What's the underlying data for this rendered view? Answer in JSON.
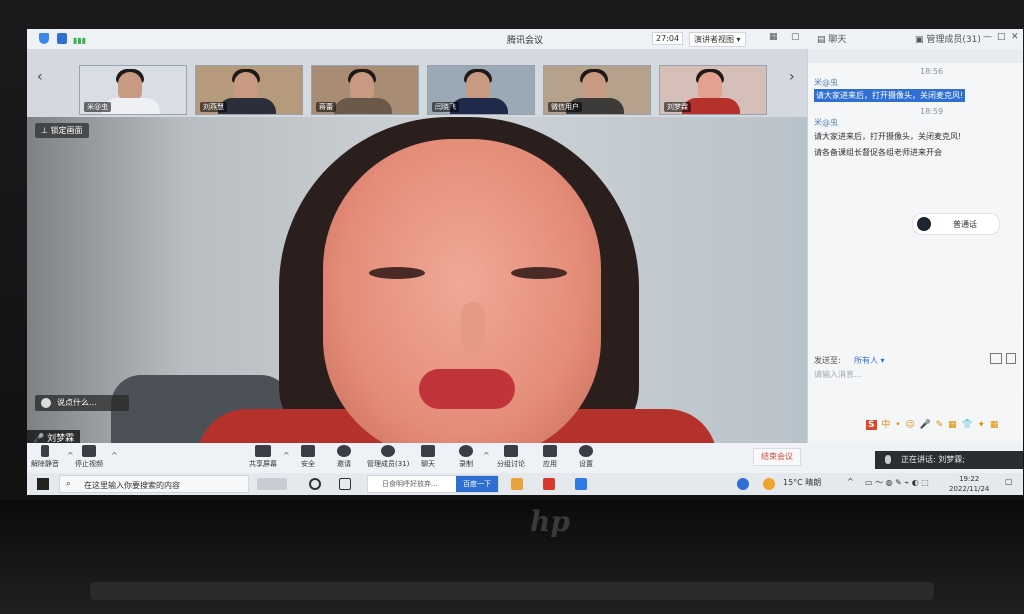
{
  "window": {
    "title": "腾讯会议",
    "timer": "27:04",
    "view_mode": "演讲者视图",
    "chat_tab": "聊天",
    "members_tab": "管理成员(31)"
  },
  "participants": [
    {
      "name": "米@虫"
    },
    {
      "name": "刘燕慧"
    },
    {
      "name": "蒋蕾"
    },
    {
      "name": "闫晓飞"
    },
    {
      "name": "微信用户"
    },
    {
      "name": "刘梦霖"
    }
  ],
  "main_video": {
    "lock_label": "锁定画面",
    "say_placeholder": "说点什么...",
    "speaker_name": "刘梦霖"
  },
  "chat": {
    "messages": [
      {
        "time": "18:56",
        "sender": "米@虫",
        "text": "请大家进来后，打开摄像头，关闭麦克风!"
      },
      {
        "time": "18:59",
        "sender": "米@虫",
        "text": "请大家进来后，打开摄像头，关闭麦克风!"
      },
      {
        "time": "",
        "sender": "",
        "text": "请各备课组长督促各组老师进来开会"
      }
    ],
    "call_label": "普通话",
    "send_to_label": "发送至:",
    "send_to_value": "所有人",
    "input_placeholder": "请输入消息..."
  },
  "toolbar": {
    "unmute": "解除静音",
    "stop_video": "停止视频",
    "share_screen": "共享屏幕",
    "security": "安全",
    "invite": "邀请",
    "members": "管理成员(31)",
    "chat": "聊天",
    "record": "录制",
    "breakout": "分组讨论",
    "apps": "应用",
    "settings": "设置",
    "end_meeting": "结束会议",
    "speaking": "正在讲话: 刘梦霖;"
  },
  "taskbar": {
    "search_placeholder": "在这里输入你要搜索的内容",
    "baidu_placeholder": "日食明呼好放弃...",
    "baidu_button": "百度一下",
    "weather": "15°C 晴朗",
    "time": "19:22",
    "date": "2022/11/24"
  },
  "colors": {
    "accent": "#2f6fd3",
    "end_meeting": "#d14b3c"
  }
}
